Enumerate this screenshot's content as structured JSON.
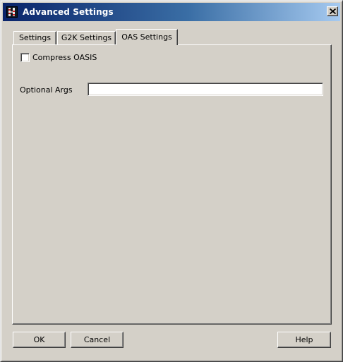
{
  "window": {
    "title": "Advanced Settings",
    "app_icon": "app-icon",
    "close_icon": "close-icon"
  },
  "tabs": [
    {
      "label": "Settings",
      "active": false
    },
    {
      "label": "G2K Settings",
      "active": false
    },
    {
      "label": "OAS Settings",
      "active": true
    }
  ],
  "oas_settings": {
    "compress_oasis": {
      "label": "Compress OASIS",
      "checked": false
    },
    "optional_args": {
      "label": "Optional Args",
      "value": ""
    }
  },
  "buttons": {
    "ok": "OK",
    "cancel": "Cancel",
    "help": "Help"
  },
  "colors": {
    "titlebar_start": "#0a246a",
    "titlebar_end": "#a6caf0",
    "face": "#d4d0c8"
  }
}
